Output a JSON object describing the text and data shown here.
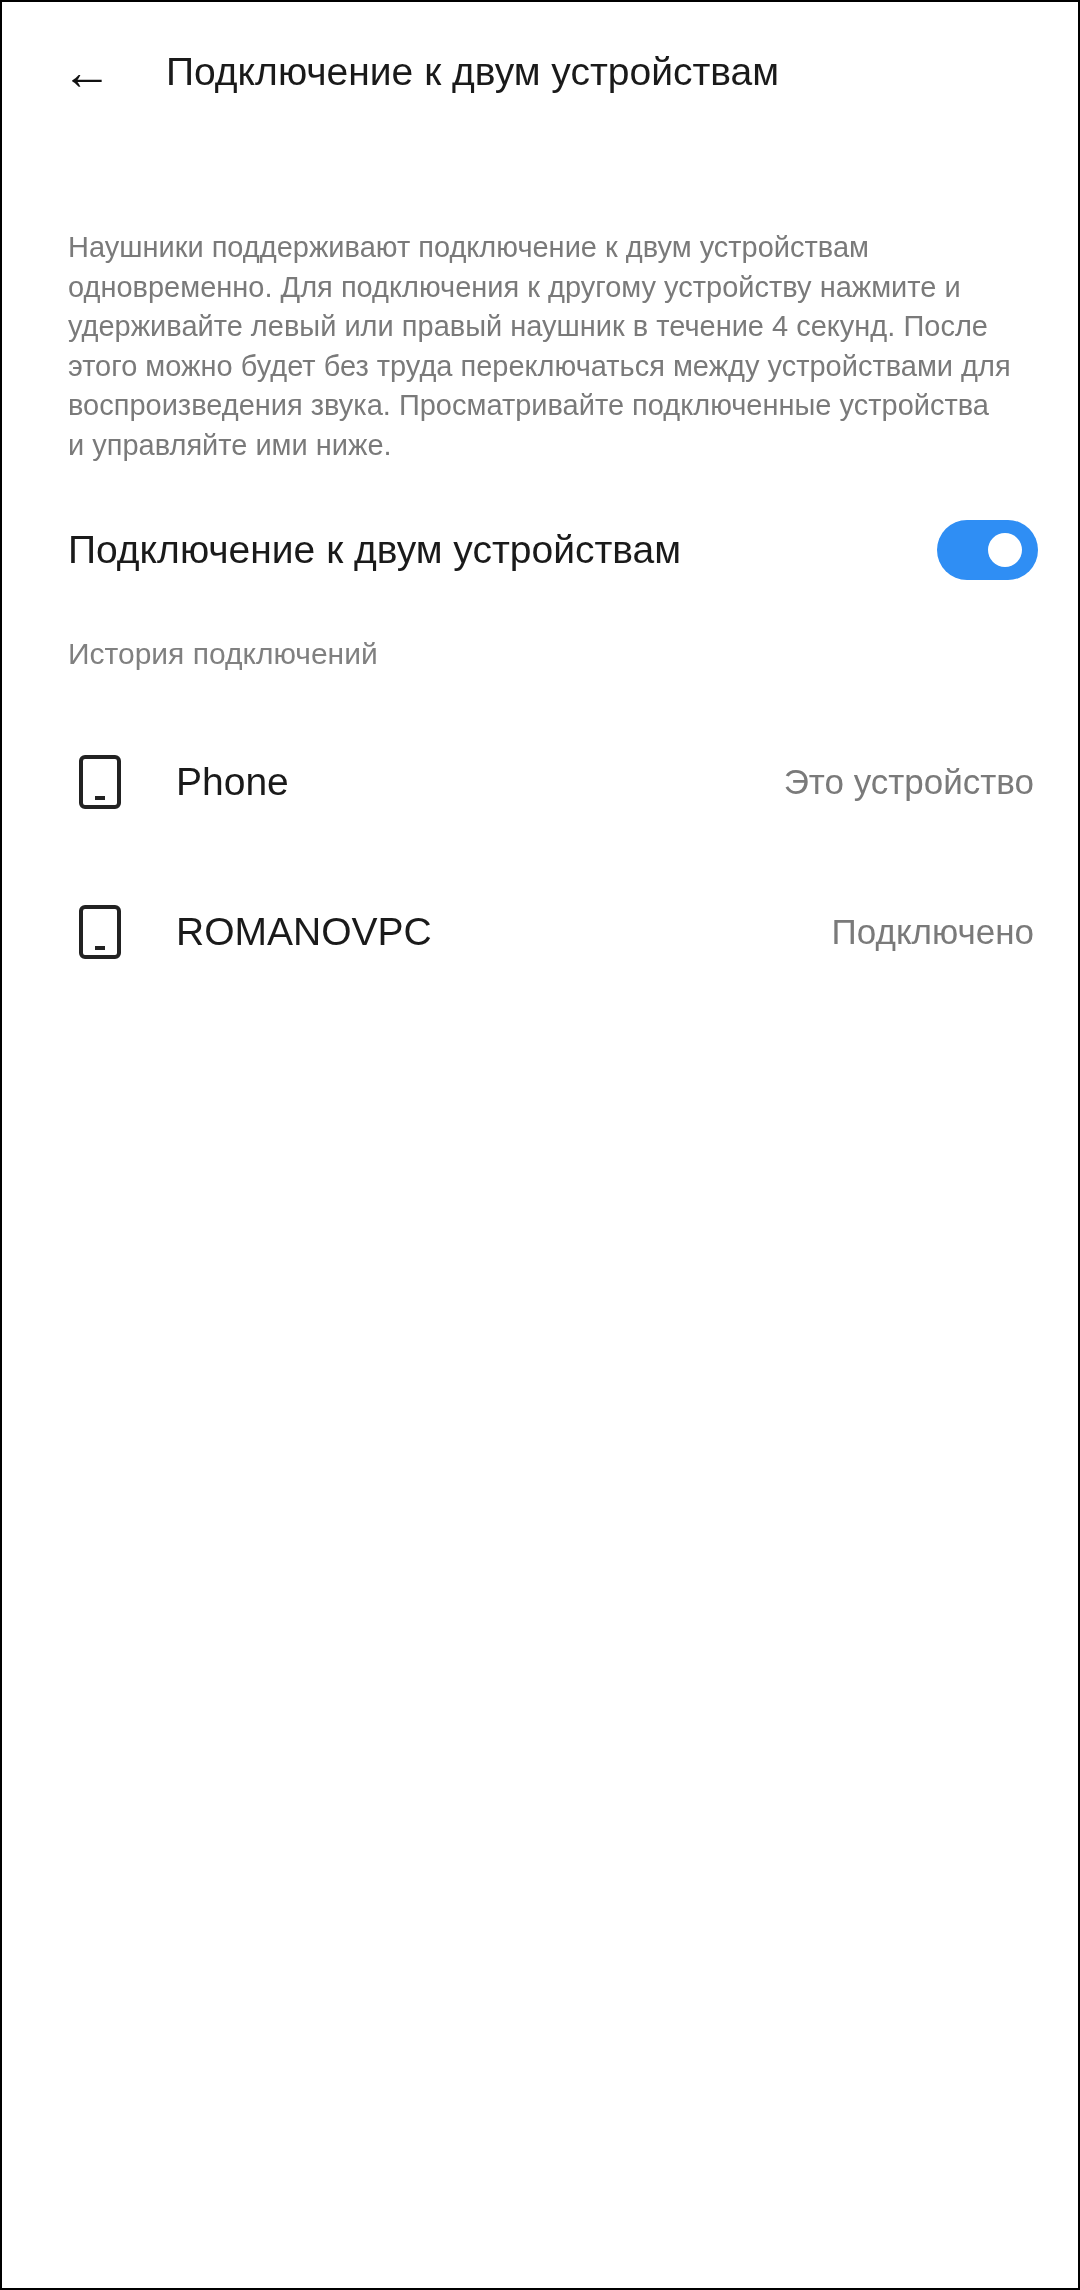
{
  "header": {
    "back_icon": "←",
    "title": "Подключение к двум устройствам"
  },
  "description": "Наушники поддерживают подключение к двум устройствам одновременно. Для подключения к другому устройству нажмите и удерживайте левый или правый наушник в течение 4 секунд. После этого можно будет без труда переключаться между устройствами для воспроизведения звука. Просматривайте подключенные устройства и управляйте ими ниже.",
  "toggle": {
    "label": "Подключение к двум устройствам",
    "on": true
  },
  "history": {
    "title": "История подключений",
    "devices": [
      {
        "name": "Phone",
        "status": "Это устройство"
      },
      {
        "name": "ROMANOVPC",
        "status": "Подключено"
      }
    ]
  }
}
